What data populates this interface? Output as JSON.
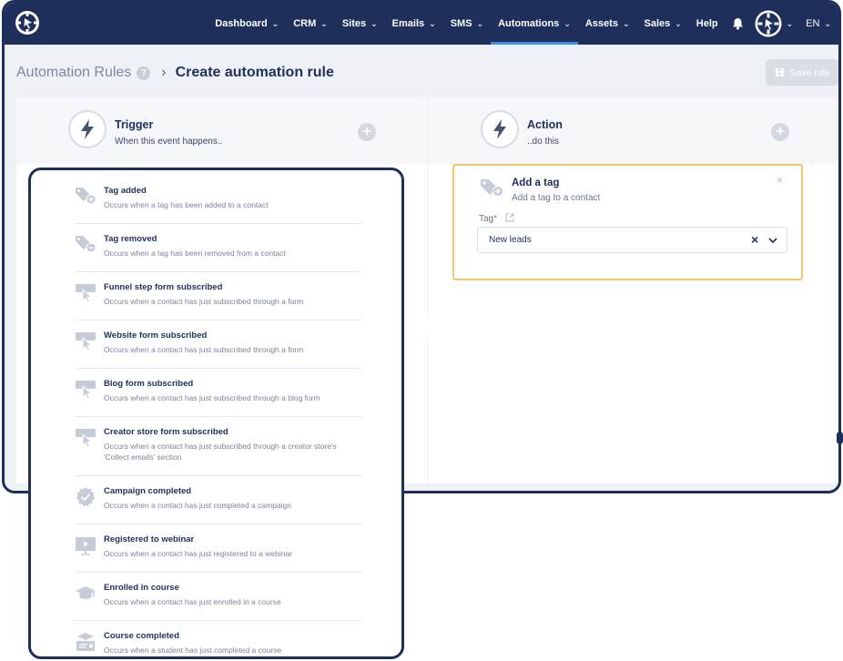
{
  "nav": {
    "items": [
      {
        "label": "Dashboard",
        "has_menu": true,
        "active": false
      },
      {
        "label": "CRM",
        "has_menu": true,
        "active": false
      },
      {
        "label": "Sites",
        "has_menu": true,
        "active": false
      },
      {
        "label": "Emails",
        "has_menu": true,
        "active": false
      },
      {
        "label": "SMS",
        "has_menu": true,
        "active": false
      },
      {
        "label": "Automations",
        "has_menu": true,
        "active": true
      },
      {
        "label": "Assets",
        "has_menu": true,
        "active": false
      },
      {
        "label": "Sales",
        "has_menu": true,
        "active": false
      },
      {
        "label": "Help",
        "has_menu": false,
        "active": false
      }
    ],
    "language": "EN",
    "bell_icon": "bell-icon",
    "chevron": "⌄"
  },
  "breadcrumb": {
    "parent": "Automation Rules",
    "help": "?",
    "separator": "›",
    "current": "Create automation rule"
  },
  "toolbar": {
    "save_label": "Save rule",
    "save_icon": "floppy-disk-icon"
  },
  "trigger": {
    "title": "Trigger",
    "subtitle": "When this event happens..",
    "icon": "lightning-icon",
    "add": "+"
  },
  "action": {
    "title": "Action",
    "subtitle": "..do this",
    "icon": "lightning-icon",
    "add": "+",
    "card": {
      "title": "Add a tag",
      "subtitle": "Add a tag to a contact",
      "close": "×",
      "field_label": "Tag",
      "required_mark": "*",
      "selected_value": "New leads",
      "clear": "×"
    }
  },
  "trigger_list": [
    {
      "title": "Tag added",
      "desc": "Occurs when a tag has been added to a contact",
      "icon": "tag-add-icon"
    },
    {
      "title": "Tag removed",
      "desc": "Occurs when a tag has been removed from a contact",
      "icon": "tag-remove-icon"
    },
    {
      "title": "Funnel step form subscribed",
      "desc": "Occurs when a contact has just subscribed through a form",
      "icon": "form-click-icon"
    },
    {
      "title": "Website form subscribed",
      "desc": "Occurs when a contact has just subscribed through a form",
      "icon": "form-click-icon"
    },
    {
      "title": "Blog form subscribed",
      "desc": "Occurs when a contact has just subscribed through a blog form",
      "icon": "form-click-icon"
    },
    {
      "title": "Creator store form subscribed",
      "desc": "Occurs when a contact has just subscribed through a creator store's 'Collect emails' section",
      "icon": "form-click-icon"
    },
    {
      "title": "Campaign completed",
      "desc": "Occurs when a contact has just completed a campaign",
      "icon": "check-badge-icon"
    },
    {
      "title": "Registered to webinar",
      "desc": "Occurs when a contact has just registered to a webinar",
      "icon": "webinar-icon"
    },
    {
      "title": "Enrolled in course",
      "desc": "Occurs when a contact has just enrolled in a course",
      "icon": "graduation-cap-icon"
    },
    {
      "title": "Course completed",
      "desc": "Occurs when a student has just completed a course",
      "icon": "course-certificate-icon"
    }
  ],
  "colors": {
    "navy": "#1e2f5c",
    "active_underline": "#3a8ee6",
    "action_border": "#f3c468",
    "icon_gray": "#c5ccd8"
  }
}
